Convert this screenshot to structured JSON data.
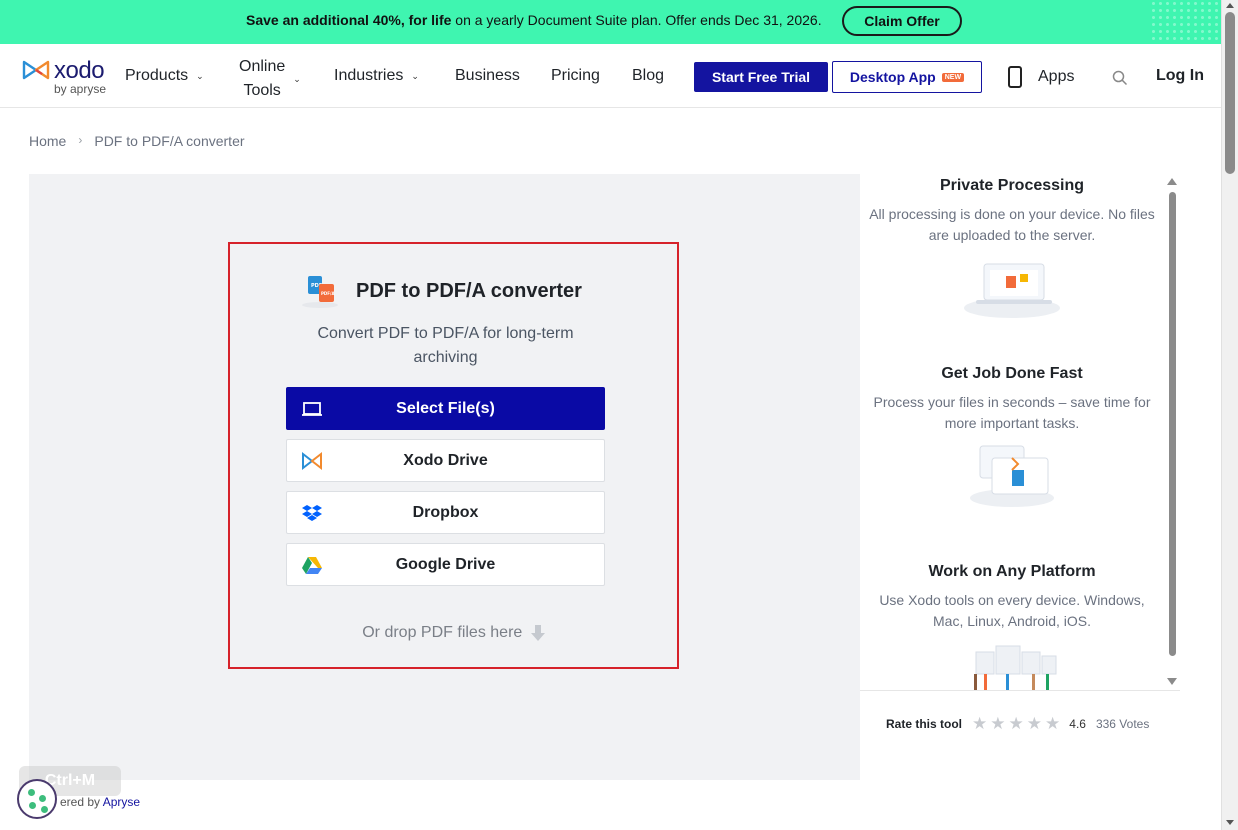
{
  "banner": {
    "bold_text": "Save an additional 40%, for life",
    "text": " on a yearly Document Suite plan. Offer ends Dec 31, 2026.",
    "claim_label": "Claim Offer"
  },
  "logo": {
    "word": "xodo",
    "sub": "by apryse"
  },
  "nav": {
    "products": "Products",
    "online_tools_1": "Online",
    "online_tools_2": "Tools",
    "industries": "Industries",
    "business": "Business",
    "pricing": "Pricing",
    "blog": "Blog",
    "start_trial": "Start Free Trial",
    "desktop_app": "Desktop App",
    "new_badge": "NEW",
    "apps": "Apps",
    "login": "Log In"
  },
  "breadcrumb": {
    "home": "Home",
    "separator": "›",
    "current": "PDF to PDF/A converter"
  },
  "converter": {
    "title": "PDF to PDF/A converter",
    "description": "Convert PDF to PDF/A for long-term archiving",
    "select_files": "Select File(s)",
    "xodo_drive": "Xodo Drive",
    "dropbox": "Dropbox",
    "google_drive": "Google Drive",
    "drop_text": "Or drop PDF files here"
  },
  "features": [
    {
      "title": "Private Processing",
      "desc": "All processing is done on your device. No files are uploaded to the server."
    },
    {
      "title": "Get Job Done Fast",
      "desc": "Process your files in seconds – save time for more important tasks."
    },
    {
      "title": "Work on Any Platform",
      "desc": "Use Xodo tools on every device. Windows, Mac, Linux, Android, iOS."
    }
  ],
  "rating": {
    "label": "Rate this tool",
    "value": "4.6",
    "votes": "336 Votes",
    "stars": 5
  },
  "footer": {
    "powered_prefix": "ered by ",
    "powered_brand": "Apryse",
    "shortcut": "Ctrl+M"
  },
  "colors": {
    "banner": "#3ff5b0",
    "primary": "#1414a0",
    "drop_border": "#d6222a",
    "workarea": "#f1f2f4"
  }
}
